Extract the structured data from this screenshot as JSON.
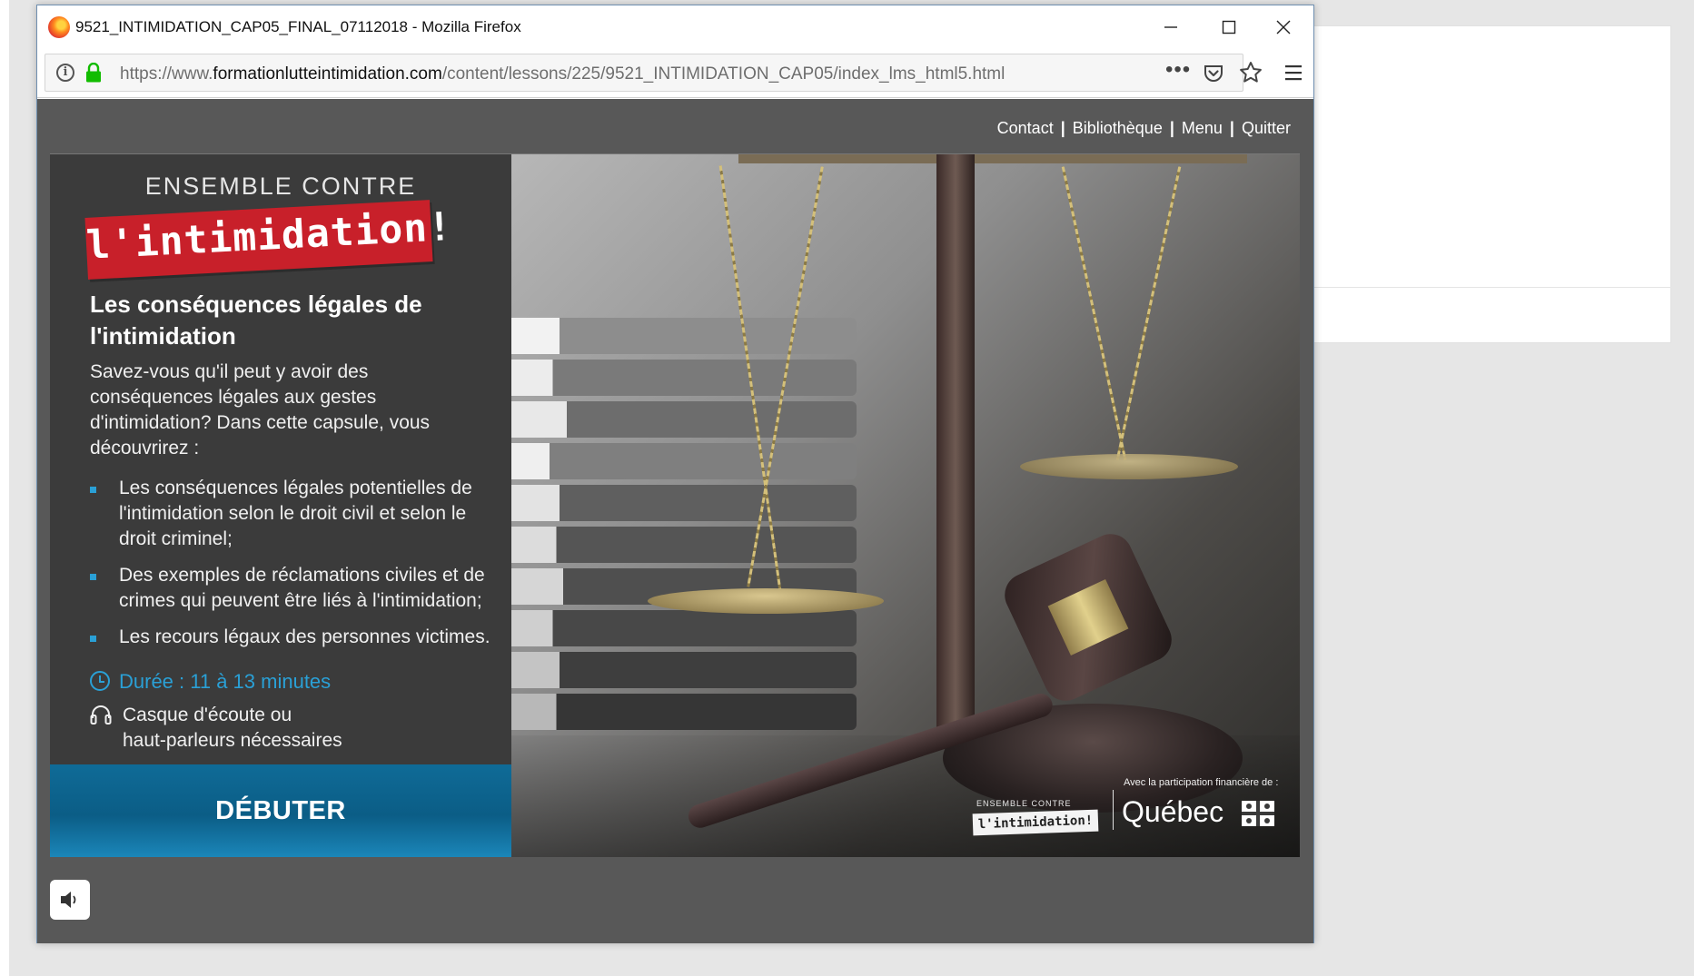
{
  "window": {
    "title": "9521_INTIMIDATION_CAP05_FINAL_07112018 - Mozilla Firefox"
  },
  "urlbar": {
    "prefix": "https://www.",
    "domain": "formationlutteintimidation.com",
    "path": "/content/lessons/225/9521_INTIMIDATION_CAP05/index_lms_html5.html",
    "info_symbol": "i",
    "more_symbol": "•••"
  },
  "topnav": {
    "contact": "Contact",
    "library": "Bibliothèque",
    "menu": "Menu",
    "quit": "Quitter",
    "separator": "|"
  },
  "logo": {
    "line1": "ENSEMBLE CONTRE",
    "line2": "l'intimidation!"
  },
  "lesson": {
    "title": "Les conséquences légales de l'intimidation",
    "intro": "Savez-vous qu'il peut y avoir des conséquences légales aux gestes d'intimidation? Dans cette capsule, vous découvrirez :",
    "bullets": [
      "Les conséquences légales potentielles de l'intimidation selon le droit civil et selon le droit criminel;",
      "Des exemples de réclamations civiles et de crimes qui peuvent être liés à l'intimidation;",
      "Les recours légaux des personnes victimes."
    ],
    "duration": "Durée : 11 à 13 minutes",
    "equipment_line1": "Casque d'écoute ou",
    "equipment_line2": "haut-parleurs nécessaires",
    "start_label": "DÉBUTER"
  },
  "credit": {
    "small_logo_top": "ENSEMBLE CONTRE",
    "small_logo_bottom": "l'intimidation!",
    "financial": "Avec la participation financière de :",
    "quebec": "Québec"
  },
  "colors": {
    "accent_blue": "#2aa0d6",
    "button_blue": "#0b5d86",
    "banner_red": "#c8202a",
    "player_gray": "#585858",
    "panel_dark": "#3b3b3b"
  },
  "icons": {
    "browser": "firefox-logo-icon",
    "minimize": "minimize-icon",
    "maximize": "maximize-icon",
    "close": "close-icon",
    "info": "info-icon",
    "lock": "lock-icon",
    "more": "more-dots-icon",
    "pocket": "pocket-icon",
    "bookmark": "star-icon",
    "menu": "hamburger-icon",
    "duration": "clock-icon",
    "equipment": "headphones-icon",
    "audio": "speaker-icon"
  }
}
